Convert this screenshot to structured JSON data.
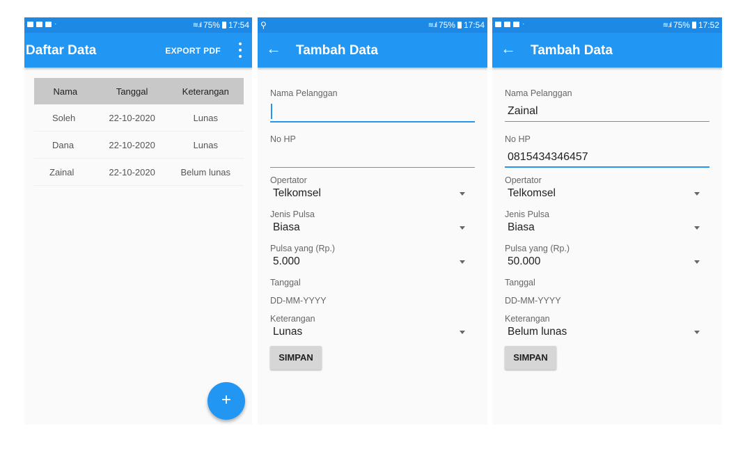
{
  "status": [
    {
      "battery": "75%",
      "time": "17:54"
    },
    {
      "battery": "75%",
      "time": "17:54"
    },
    {
      "battery": "75%",
      "time": "17:52"
    }
  ],
  "list_screen": {
    "title": "Daftar Data",
    "export_label": "EXPORT PDF",
    "columns": [
      "Nama",
      "Tanggal",
      "Keterangan"
    ],
    "rows": [
      [
        "Soleh",
        "22-10-2020",
        "Lunas"
      ],
      [
        "Dana",
        "22-10-2020",
        "Lunas"
      ],
      [
        "Zainal",
        "22-10-2020",
        "Belum lunas"
      ]
    ],
    "fab_label": "+"
  },
  "form_labels": {
    "title": "Tambah Data",
    "nama": "Nama Pelanggan",
    "nohp": "No HP",
    "operator": "Opertator",
    "jenis": "Jenis Pulsa",
    "pulsa": "Pulsa yang (Rp.)",
    "tanggal": "Tanggal",
    "tanggal_hint": "DD-MM-YYYY",
    "keterangan": "Keterangan",
    "simpan": "SIMPAN"
  },
  "form_a": {
    "nama": "",
    "nohp": "",
    "operator": "Telkomsel",
    "jenis": "Biasa",
    "pulsa": "5.000",
    "keterangan": "Lunas"
  },
  "form_b": {
    "nama": "Zainal",
    "nohp": "0815434346457",
    "operator": "Telkomsel",
    "jenis": "Biasa",
    "pulsa": "50.000",
    "keterangan": "Belum lunas"
  },
  "colors": {
    "primary": "#2196f3",
    "status_bar": "#1e88e5"
  }
}
